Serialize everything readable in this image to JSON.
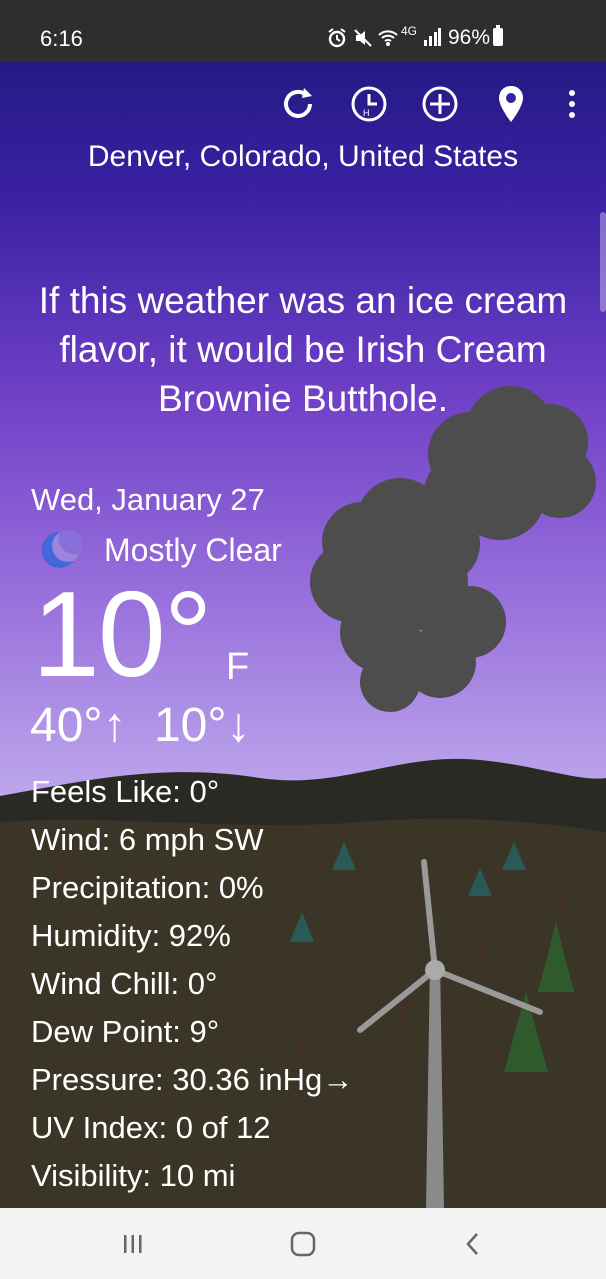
{
  "status_bar": {
    "time": "6:16",
    "network": "4G",
    "battery": "96%"
  },
  "toolbar": {
    "icons": [
      "refresh-icon",
      "hourly-clock-icon",
      "add-location-icon",
      "location-pin-icon",
      "more-vert-icon"
    ]
  },
  "location": "Denver, Colorado, United States",
  "flavor_text": "If this weather was an ice cream flavor, it would be Irish Cream Brownie Butthole.",
  "date": "Wed, January 27",
  "condition": {
    "icon": "moon-icon",
    "text": "Mostly Clear"
  },
  "temperature": {
    "current": "10°",
    "unit": "F",
    "high": "40°",
    "low": "10°",
    "high_arrow": "↑",
    "low_arrow": "↓"
  },
  "details": {
    "feels_like": "Feels Like: 0°",
    "wind": "Wind: 6 mph SW",
    "precipitation": "Precipitation: 0%",
    "humidity": "Humidity: 92%",
    "wind_chill": "Wind Chill: 0°",
    "dew_point": "Dew Point: 9°",
    "pressure": "Pressure: 30.36 inHg→",
    "uv_index": "UV Index: 0 of 12",
    "visibility": "Visibility: 10 mi"
  },
  "colors": {
    "sky_top": "#241a84",
    "sky_bottom": "#cbb8f0",
    "ground": "#3a3526",
    "cloud": "#4d4d4d"
  }
}
